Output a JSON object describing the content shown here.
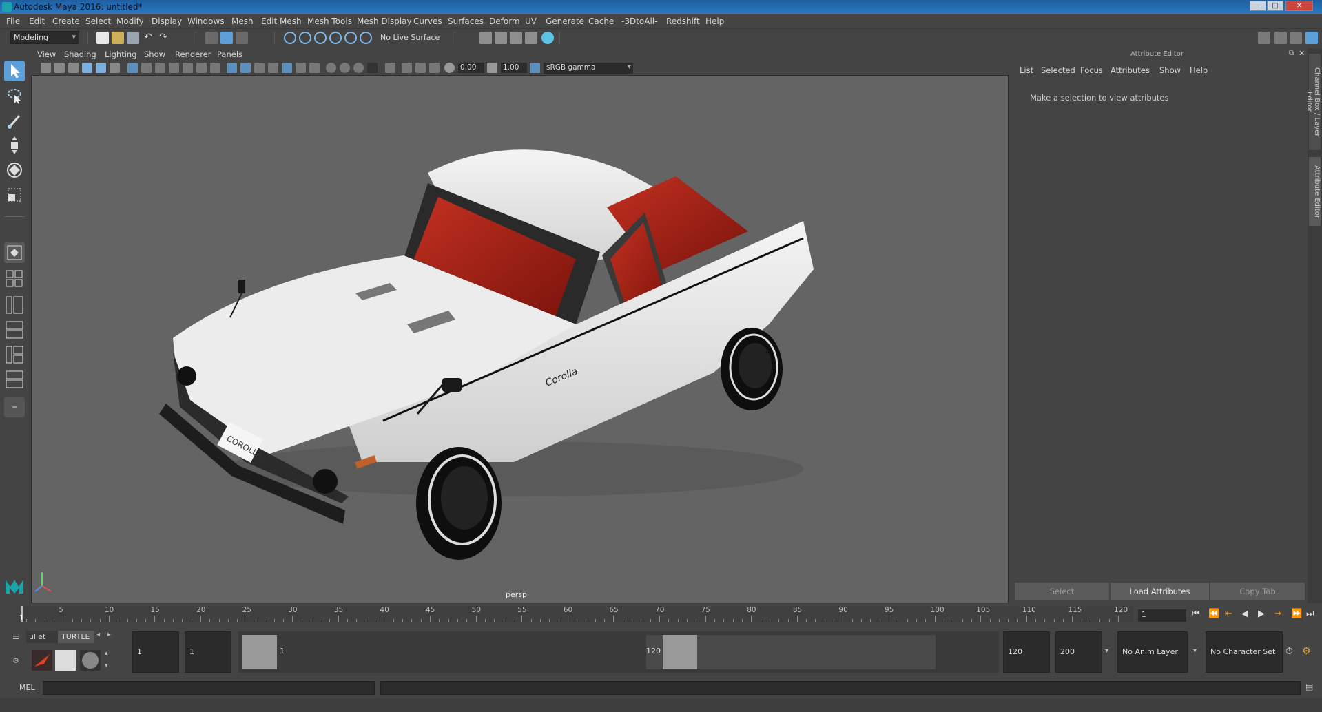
{
  "window": {
    "title": "Autodesk Maya 2016: untitled*"
  },
  "menu": [
    "File",
    "Edit",
    "Create",
    "Select",
    "Modify",
    "Display",
    "Windows",
    "Mesh",
    "Edit Mesh",
    "Mesh Tools",
    "Mesh Display",
    "Curves",
    "Surfaces",
    "Deform",
    "UV",
    "Generate",
    "Cache",
    "-3DtoAll-",
    "Redshift",
    "Help"
  ],
  "shelf": {
    "mode": "Modeling",
    "live_surface": "No Live Surface"
  },
  "viewport": {
    "menu": [
      "View",
      "Shading",
      "Lighting",
      "Show",
      "Renderer",
      "Panels"
    ],
    "exposure": "0.00",
    "gamma": "1.00",
    "colorspace": "sRGB gamma",
    "camera_label": "persp",
    "car": {
      "badge": "Corolla",
      "plate": "COROLLA"
    }
  },
  "attribute_editor": {
    "header": "Attribute Editor",
    "menu": [
      "List",
      "Selected",
      "Focus",
      "Attributes",
      "Show",
      "Help"
    ],
    "message": "Make a selection to view attributes",
    "buttons": {
      "select": "Select",
      "load": "Load Attributes",
      "copy": "Copy Tab"
    }
  },
  "side_tabs": {
    "channel_box": "Channel Box / Layer Editor",
    "attribute_editor": "Attribute Editor"
  },
  "timeline": {
    "ticks": [
      "5",
      "10",
      "15",
      "20",
      "25",
      "30",
      "35",
      "40",
      "45",
      "50",
      "55",
      "60",
      "65",
      "70",
      "75",
      "80",
      "85",
      "90",
      "95",
      "100",
      "105",
      "110",
      "115",
      "120"
    ],
    "start_tick": "1",
    "current_frame": "1"
  },
  "range": {
    "shelf_tabs": [
      "ullet",
      "TURTLE"
    ],
    "start": "1",
    "playback_start": "1",
    "range_start": "1",
    "range_end": "120",
    "playback_end": "120",
    "end": "200",
    "anim_layer": "No Anim Layer",
    "character_set": "No Character Set"
  },
  "command_line": {
    "label": "MEL"
  }
}
